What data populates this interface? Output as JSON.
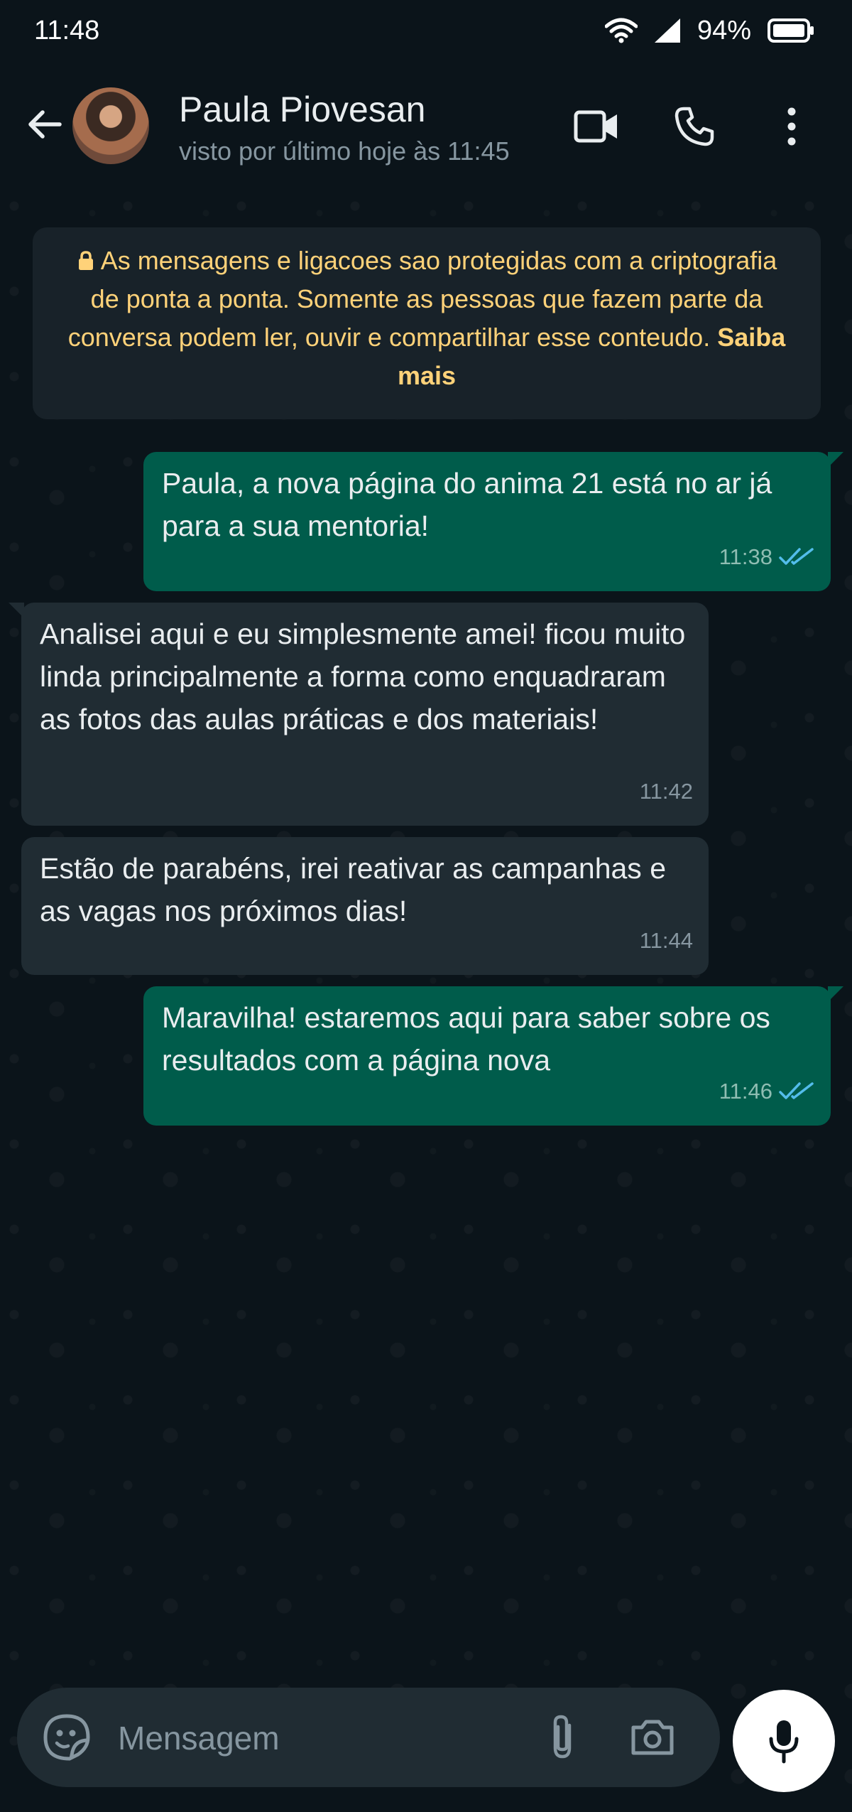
{
  "status_bar": {
    "time": "11:48",
    "battery": "94%"
  },
  "header": {
    "contact_name": "Paula Piovesan",
    "last_seen": "visto por último hoje às 11:45",
    "icons": [
      "back-arrow-icon",
      "video-call-icon",
      "phone-icon",
      "more-options-icon"
    ]
  },
  "encryption_notice": {
    "text": "As mensagens e ligacoes sao protegidas com a criptografia de ponta a ponta. Somente as pessoas que fazem parte da conversa podem ler, ouvir e compartilhar esse conteudo.",
    "link": "Saiba mais"
  },
  "messages": [
    {
      "direction": "out",
      "text": "Paula, a nova página do anima 21 está no ar já para a sua mentoria!",
      "time": "11:38",
      "status": "read"
    },
    {
      "direction": "in",
      "text": "Analisei aqui e eu simplesmente amei! ficou muito linda principalmente a forma como enquadraram as fotos das aulas práticas e dos materiais!",
      "time": "11:42"
    },
    {
      "direction": "in",
      "text": "Estão de parabéns, irei reativar as campanhas e as vagas nos próximos dias!",
      "time": "11:44"
    },
    {
      "direction": "out",
      "text": "Maravilha! estaremos aqui para saber sobre os resultados com a página nova",
      "time": "11:46",
      "status": "read"
    }
  ],
  "composer": {
    "placeholder": "Mensagem",
    "icons": [
      "emoji-icon",
      "attach-icon",
      "camera-icon",
      "mic-icon"
    ]
  },
  "colors": {
    "background": "#0b141a",
    "outgoing_bubble": "#005c4b",
    "incoming_bubble": "#202c33",
    "notice_text": "#ffd279",
    "read_tick": "#53bdeb"
  }
}
